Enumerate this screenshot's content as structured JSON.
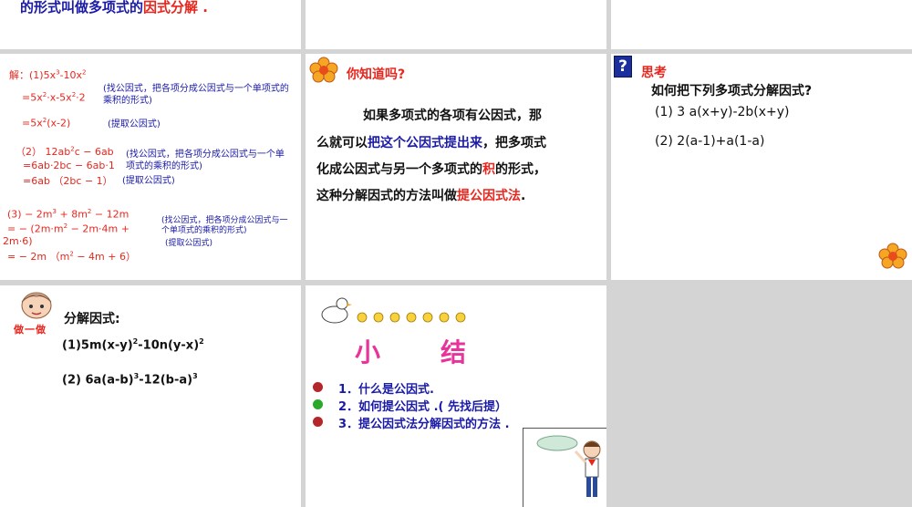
{
  "colors": {
    "red": "#e8261e",
    "blue": "#1a1aa8",
    "bullet_red": "#b3262a",
    "bullet_green": "#2aa82a",
    "bg": "#d4d4d4"
  },
  "slide1": {
    "t1": "的形式叫做多项式的",
    "t2": "因式分解",
    "t3": " ."
  },
  "slide4": {
    "l1a": "解：(1)5x",
    "l1b": "3",
    "l1c": "-10x",
    "l1d": "2",
    "l2a": "=5x",
    "l2b": "2",
    "l2c": "·x-5x",
    "l2d": "2",
    "l2e": "·2",
    "note1": "(找公因式，把各项分成公因式与一个单项式的乘积的形式)",
    "l3a": "=5x",
    "l3b": "2",
    "l3c": "(x-2)",
    "note2": "(提取公因式)",
    "l4a": "（2） 12ab",
    "l4b": "2",
    "l4c": "c − 6ab",
    "note3": "(找公因式，把各项分成公因式与一个单项式的乘积的形式)",
    "l5": "=6ab·2bc − 6ab·1",
    "l6": "=6ab （2bc − 1）",
    "note4": "(提取公因式)",
    "l7a": "(3) − 2m",
    "l7b": "3",
    "l7c": " + 8m",
    "l7d": "2",
    "l7e": " − 12m",
    "l8a": "= − (2m·m",
    "l8b": "2",
    "l8c": " − 2m·4m +",
    "l9": "2m·6)",
    "note5": "(找公因式，把各项分成公因式与一个单项式的乘积的形式)",
    "note6": "(提取公因式)",
    "l10a": "= − 2m （m",
    "l10b": "2",
    "l10c": " − 4m + 6）"
  },
  "slide5": {
    "title": "你知道吗?",
    "p1": "如果多项式的各项有公因式，那",
    "p2a": "么就可以",
    "p2b": "把这个公因式提出来",
    "p2c": "，把多项式",
    "p3a": "化成公因式与另一个多项式的",
    "p3b": "积",
    "p3c": "的形式，",
    "p4a": "这种分解因式的方法叫做",
    "p4b": "提公因式法",
    "p4c": "."
  },
  "slide6": {
    "icon": "?",
    "title": "思考",
    "q": "如何把下列多项式分解因式?",
    "i1": "(1)   3  a(x+y)-2b(x+y)",
    "i2": "(2)   2(a-1)+a(1-a)"
  },
  "slide7": {
    "badge": "做一做",
    "title": "分解因式:",
    "e1a": "(1)5m(x-y)",
    "e1b": "2",
    "e1c": "-10n(y-x)",
    "e1d": "2",
    "e2a": "(2) 6a(a-b)",
    "e2b": "3",
    "e2c": "-12(b-a)",
    "e2d": "3"
  },
  "slide8": {
    "t1": "小",
    "t2": "结",
    "b1": "1．什么是公因式.",
    "b2": "2．如何提公因式 .( 先找后提）",
    "b3": "3．提公因式法分解因式的方法 ."
  }
}
